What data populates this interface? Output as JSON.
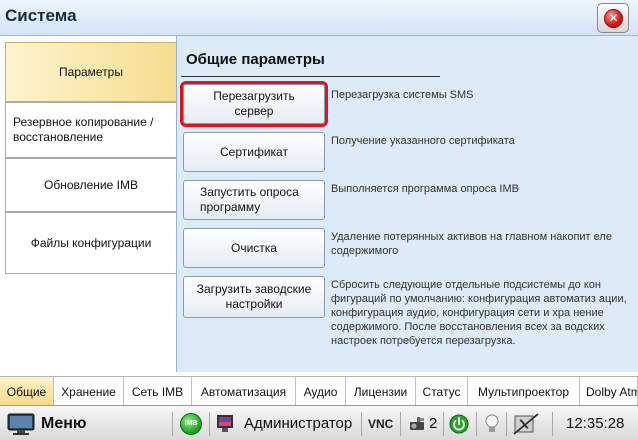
{
  "window": {
    "title": "Система"
  },
  "side_tabs": [
    {
      "label": "Параметры",
      "active": true
    },
    {
      "label": "Резервное копирование / восстановление",
      "active": false
    },
    {
      "label": "Обновление IMB",
      "active": false
    },
    {
      "label": "Файлы конфигурации",
      "active": false
    }
  ],
  "section": {
    "heading": "Общие параметры"
  },
  "actions": [
    {
      "button": "Перезагрузить сервер",
      "description": "Перезагрузка системы SMS",
      "highlighted": true
    },
    {
      "button": "Сертификат",
      "description": "Получение указанного сертификата",
      "highlighted": false
    },
    {
      "button": "Запустить опроса программу",
      "description": "Выполняется программа опроса IMB",
      "highlighted": false
    },
    {
      "button": "Очистка",
      "description": "Удаление потерянных активов на главном накопит еле содержимого",
      "highlighted": false
    },
    {
      "button": "Загрузить заводские настройки",
      "description": "Сбросить следующие отдельные подсистемы до кон фигураций по умолчанию:  конфигурация автоматиз ации, конфигурация аудио, конфигурация сети и хра нение содержимого. После восстановления всех за водских настроек потребуется перезагрузка.",
      "highlighted": false
    }
  ],
  "bottom_tabs": [
    {
      "label": "Общие",
      "active": true
    },
    {
      "label": "Хранение",
      "active": false
    },
    {
      "label": "Сеть IMB",
      "active": false
    },
    {
      "label": "Автоматизация",
      "active": false
    },
    {
      "label": "Аудио",
      "active": false
    },
    {
      "label": "Лицензии",
      "active": false
    },
    {
      "label": "Статус",
      "active": false
    },
    {
      "label": "Мультипроектор",
      "active": false
    },
    {
      "label": "Dolby Atmos",
      "active": false
    }
  ],
  "taskbar": {
    "menu_label": "Меню",
    "imb_badge": "IMB",
    "user": "Администратор",
    "vnc": "VNC",
    "projector_count": "2",
    "clock": "12:35:28"
  },
  "colors": {
    "highlight_border": "#e0141b",
    "active_tab": "#f5d98a",
    "panel_bg": "#ddeaf7"
  }
}
